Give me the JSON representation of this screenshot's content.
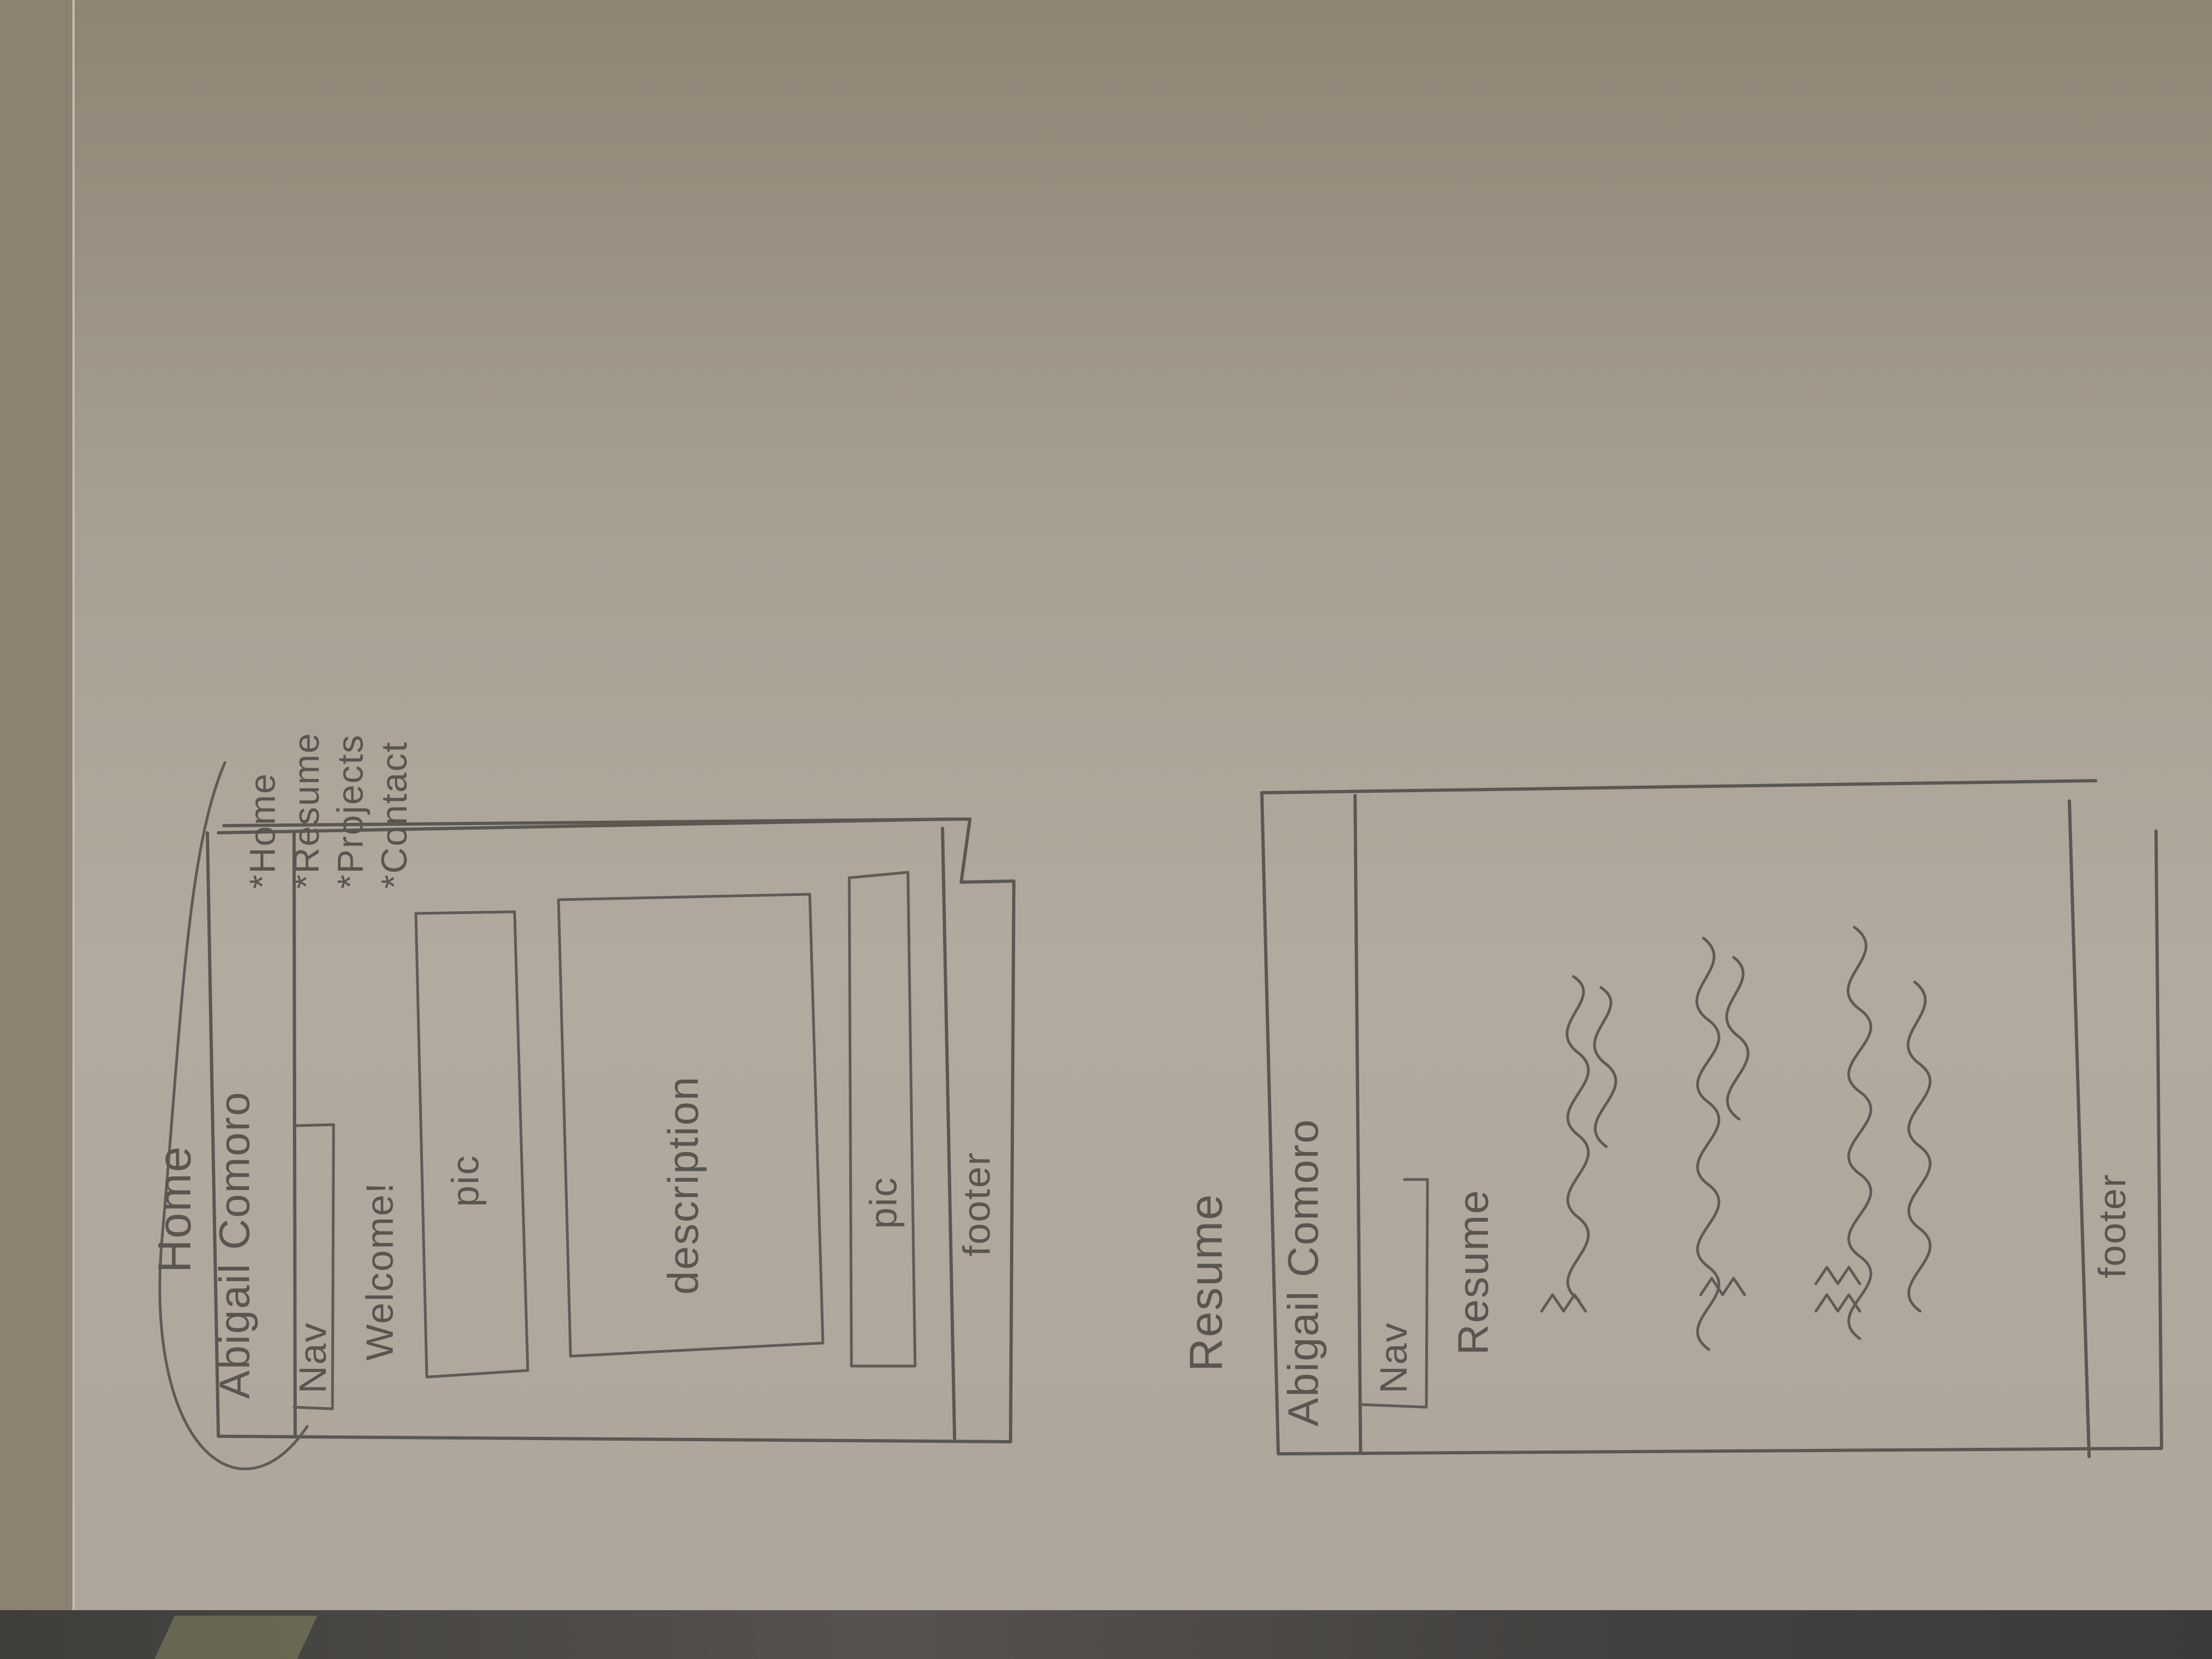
{
  "background": {
    "paper_color": "#aea69a",
    "ink_color": "#5b5752"
  },
  "home": {
    "page_label": "Home",
    "site_name": "Abigail Comoro",
    "nav_label": "Nav",
    "welcome": "Welcome!",
    "pic_top": "pic",
    "description": "description",
    "pic_bottom": "pic",
    "footer": "footer",
    "nav_items": [
      "*Home",
      "*Resume",
      "*Projects",
      "*Contact"
    ]
  },
  "resume": {
    "page_label": "Resume",
    "site_name": "Abigail Comoro",
    "nav_label": "Nav",
    "heading": "Resume",
    "footer": "footer"
  }
}
